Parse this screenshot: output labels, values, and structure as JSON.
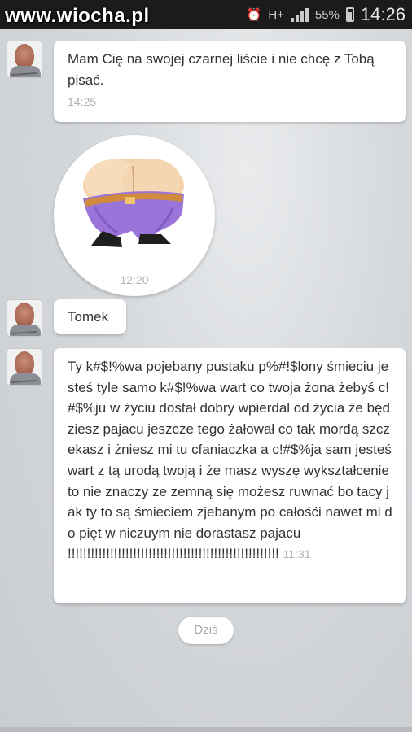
{
  "status_bar": {
    "watermark": "www.wiocha.pl",
    "network": "H+",
    "battery": "55%",
    "time": "14:26",
    "icons": [
      "skype-icon",
      "weather-icon",
      "alarm-icon",
      "network-icon",
      "signal-icon",
      "battery-icon"
    ]
  },
  "messages": [
    {
      "type": "text",
      "text": "Mam Cię na swojej czarnej liście i nie chcę z Tobą pisać.",
      "time": "14:25"
    },
    {
      "type": "sticker",
      "sticker": "cartoon-butt-in-purple-pants",
      "time": "12:20"
    },
    {
      "type": "text",
      "text": "Tomek"
    },
    {
      "type": "text",
      "text": "Ty k#$!%wa pojebany pustaku p%#!$lony śmieciu jesteś tyle samo k#$!%wa wart co twoja żona żebyś c!#$%ju w życiu dostał dobry wpierdal od życia że będziesz pajacu jeszcze tego żałował co tak mordą szczekasz i żniesz mi tu cfaniaczka a c!#$%ja sam jesteś wart z tą urodą twoją i że masz wyszę wykształcenie to nie znaczy ze zemną się możesz ruwnać bo tacy jak ty to są śmieciem zjebanym po całośći nawet mi do pięt w niczuym nie dorastasz pajacu !!!!!!!!!!!!!!!!!!!!!!!!!!!!!!!!!!!!!!!!!!!!!!!!!!!!!!!",
      "time": "11:31"
    }
  ],
  "date_separator": "Dziś"
}
